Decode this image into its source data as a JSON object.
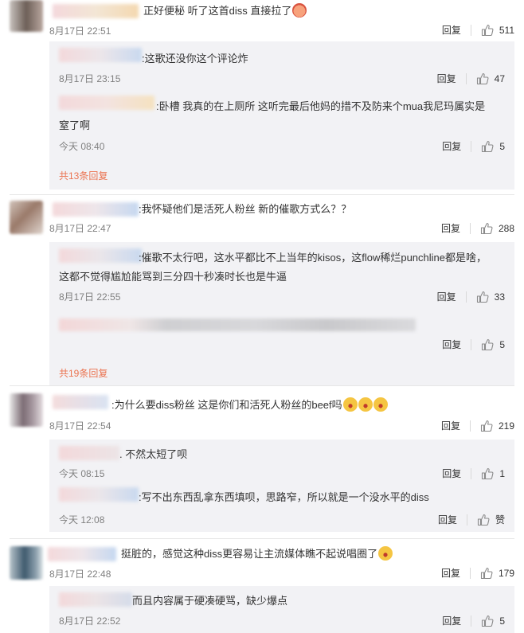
{
  "colors": {
    "accent": "#eb7350",
    "reply_bg": "#f2f2f5",
    "meta": "#808080"
  },
  "comments": [
    {
      "text": "正好便秘 听了这首diss 直接拉了",
      "time": "8月17日 22:51",
      "reply_label": "回复",
      "likes": "511",
      "replies": [
        {
          "text": ":这歌还没你这个评论炸",
          "time": "8月17日 23:15",
          "reply_label": "回复",
          "likes": "47"
        },
        {
          "text_line1": ":卧槽 我真的在上厕所  这听完最后他妈的措不及防来个mua我尼玛属实是",
          "text_line2": "窒了啊",
          "time": "今天 08:40",
          "reply_label": "回复",
          "likes": "5"
        }
      ],
      "more": "共13条回复"
    },
    {
      "text": ":我怀疑他们是活死人粉丝 新的催歌方式么？？",
      "time": "8月17日 22:47",
      "reply_label": "回复",
      "likes": "288",
      "replies": [
        {
          "text_line1": ":催歌不太行吧，这水平都比不上当年的kisos，这flow稀烂punchline都是啥，",
          "text_line2": "这都不觉得尴尬能骂到三分四十秒凑时长也是牛逼",
          "time": "8月17日 22:55",
          "reply_label": "回复",
          "likes": "33"
        },
        {
          "reply_label": "回复",
          "likes": "5"
        }
      ],
      "more": "共19条回复"
    },
    {
      "text": ":为什么要diss粉丝 这是你们和活死人粉丝的beef吗",
      "time": "8月17日 22:54",
      "reply_label": "回复",
      "likes": "219",
      "replies": [
        {
          "text": ". 不然太短了呗",
          "time": "今天 08:15",
          "reply_label": "回复",
          "likes": "1"
        },
        {
          "text": ":写不出东西乱拿东西填呗，思路窄，所以就是一个没水平的diss",
          "time": "今天 12:08",
          "reply_label": "回复",
          "likes": "赞"
        }
      ]
    },
    {
      "text": "挺脏的，感觉这种diss更容易让主流媒体瞧不起说唱圈了",
      "time": "8月17日 22:48",
      "reply_label": "回复",
      "likes": "179",
      "replies": [
        {
          "text": "而且内容属于硬凑硬骂，缺少爆点",
          "time": "8月17日 22:52",
          "reply_label": "回复",
          "likes": "5"
        }
      ]
    }
  ]
}
